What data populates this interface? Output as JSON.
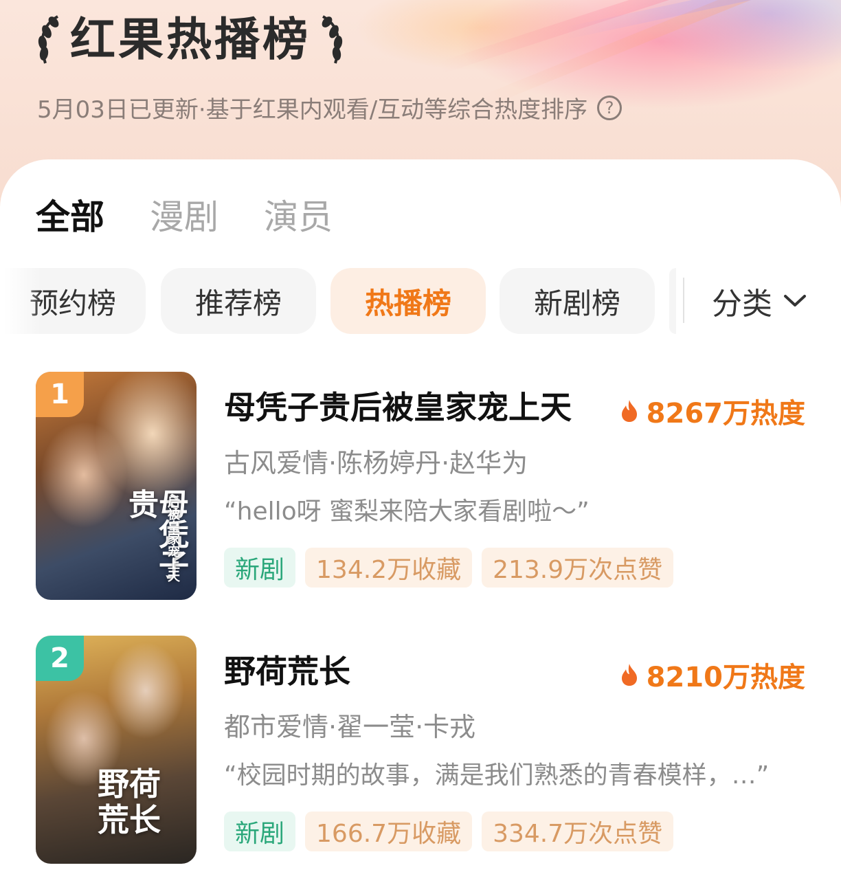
{
  "header": {
    "title": "红果热播榜",
    "subtitle": "5月03日已更新·基于红果内观看/互动等综合热度排序",
    "help_icon": "question-circle-icon"
  },
  "tabs": [
    {
      "label": "全部",
      "active": true
    },
    {
      "label": "漫剧",
      "active": false
    },
    {
      "label": "演员",
      "active": false
    }
  ],
  "chips": [
    {
      "label": "预约榜",
      "active": false
    },
    {
      "label": "推荐榜",
      "active": false
    },
    {
      "label": "热播榜",
      "active": true
    },
    {
      "label": "新剧榜",
      "active": false
    }
  ],
  "category_label": "分类",
  "items": [
    {
      "rank": "1",
      "rank_color": "#f5a04a",
      "title": "母凭子贵后被皇家宠上天",
      "heat": "8267万热度",
      "meta": "古风爱情·陈杨婷丹·赵华为",
      "quote": "“hello呀 蜜梨来陪大家看剧啦～”",
      "tags": {
        "new": "新剧",
        "favorites": "134.2万收藏",
        "likes": "213.9万次点赞"
      },
      "poster_title": "母凭子贵",
      "poster_subtitle": "后被皇家宠上天"
    },
    {
      "rank": "2",
      "rank_color": "#3cc2a4",
      "title": "野荷荒长",
      "heat": "8210万热度",
      "meta": "都市爱情·翟一莹·卡戎",
      "quote": "“校园时期的故事，满是我们熟悉的青春模样，…”",
      "tags": {
        "new": "新剧",
        "favorites": "166.7万收藏",
        "likes": "334.7万次点赞"
      },
      "poster_title": "野荷荒长",
      "poster_subtitle": ""
    }
  ],
  "colors": {
    "accent": "#f07818",
    "new_tag": "#2aa77a",
    "stat_tag": "#d89a63"
  }
}
